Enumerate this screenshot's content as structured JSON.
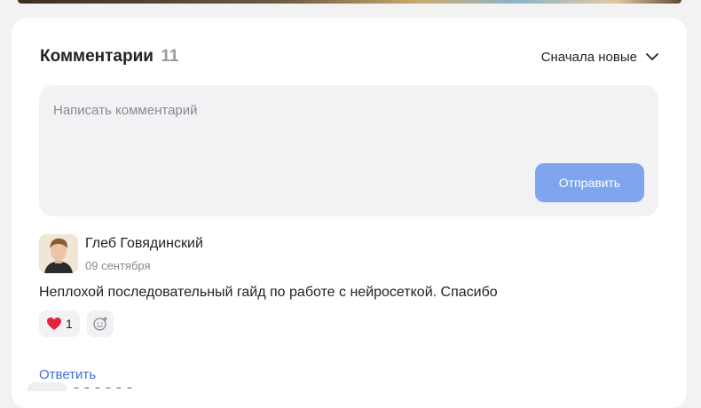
{
  "comments": {
    "title": "Комментарии",
    "count": "11",
    "sort_label": "Сначала новые",
    "composer_placeholder": "Написать комментарий",
    "send_label": "Отправить"
  },
  "comment": {
    "author": "Глеб Говядинский",
    "date": "09 сентября",
    "text": "Неплохой последовательный гайд по работе с нейросеткой. Спасибо",
    "reaction_count": "1",
    "reply_label": "Ответить"
  },
  "icons": {
    "sort": "chevron-down-icon",
    "reaction": "heart-icon",
    "add_reaction": "add-reaction-icon"
  },
  "colors": {
    "send_button": "#7fa5ef",
    "reply_link": "#3d6fd8",
    "heart": "#e3243b"
  }
}
